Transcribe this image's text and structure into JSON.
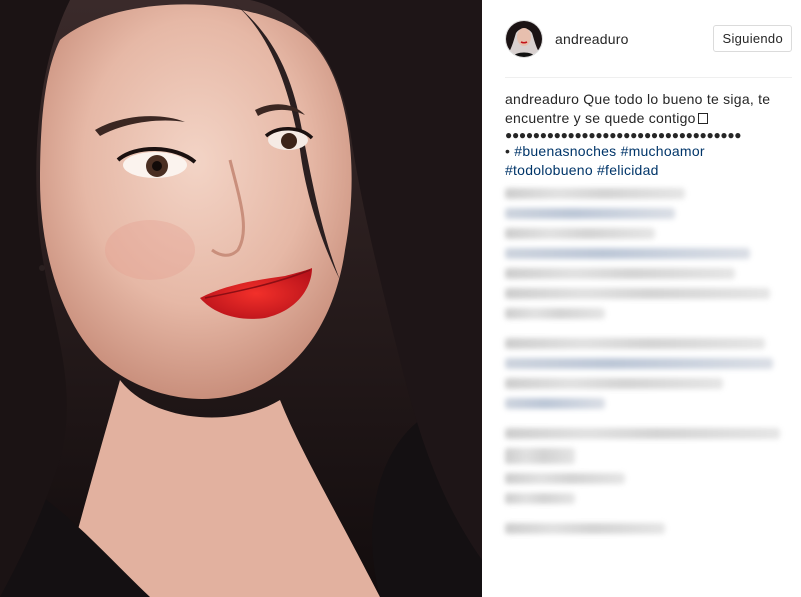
{
  "post": {
    "author": {
      "username": "andreaduro",
      "avatar_icon": "profile-avatar"
    },
    "follow_button_label": "Siguiendo",
    "caption": {
      "author": "andreaduro",
      "text": "Que todo lo bueno te siga, te encuentre y se quede contigo",
      "dots": "●●●●●●●●●●●●●●●●●●●●●●●●●●●●●●●●●●",
      "bullet": "•",
      "hashtags": [
        "#buenasnoches",
        "#muchoamor",
        "#todolobueno",
        "#felicidad"
      ]
    },
    "comments_blurred": true
  },
  "colors": {
    "link": "#003569",
    "text": "#262626",
    "border": "#dbdbdb"
  }
}
